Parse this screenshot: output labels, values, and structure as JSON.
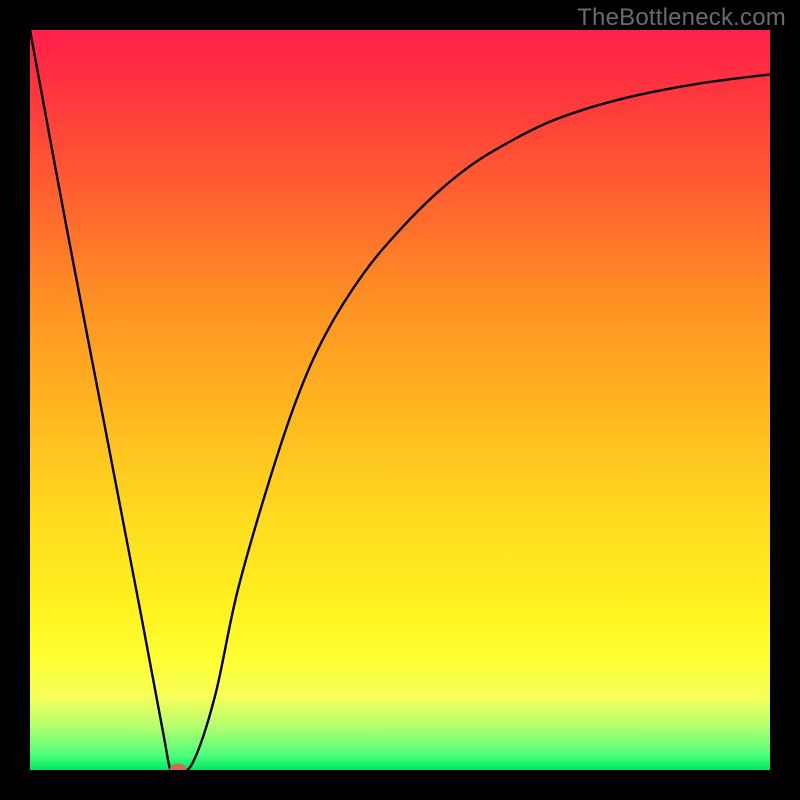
{
  "watermark": "TheBottleneck.com",
  "colors": {
    "frame": "#000000",
    "dot": "#d06a54",
    "curve": "#000000",
    "watermark": "#6b6b6b"
  },
  "gradient_stops": [
    {
      "pct": 0,
      "color": "#ff1f4b"
    },
    {
      "pct": 10,
      "color": "#ff3a3c"
    },
    {
      "pct": 25,
      "color": "#ff6a2d"
    },
    {
      "pct": 38,
      "color": "#ff9522"
    },
    {
      "pct": 52,
      "color": "#ffb81f"
    },
    {
      "pct": 65,
      "color": "#ffd91f"
    },
    {
      "pct": 78,
      "color": "#fff21f"
    },
    {
      "pct": 85,
      "color": "#ffff33"
    },
    {
      "pct": 90,
      "color": "#f7ff58"
    },
    {
      "pct": 94,
      "color": "#b7ff6e"
    },
    {
      "pct": 98,
      "color": "#4cff7a"
    },
    {
      "pct": 100,
      "color": "#00e765"
    }
  ],
  "chart_data": {
    "type": "line",
    "title": "",
    "xlabel": "",
    "ylabel": "",
    "xlim": [
      0,
      100
    ],
    "ylim": [
      0,
      100
    ],
    "grid": false,
    "legend": false,
    "series": [
      {
        "name": "curve",
        "x": [
          0,
          5,
          10,
          15,
          18,
          19,
          20,
          22,
          25,
          28,
          32,
          36,
          40,
          45,
          50,
          55,
          60,
          65,
          70,
          75,
          80,
          85,
          90,
          95,
          100
        ],
        "y": [
          100,
          73,
          47,
          21,
          5,
          0,
          0,
          1,
          10,
          24,
          38,
          50,
          59,
          67,
          73,
          78,
          82,
          85,
          87.5,
          89.3,
          90.7,
          91.8,
          92.7,
          93.4,
          94
        ]
      }
    ],
    "marker": {
      "x": 20,
      "y": 0,
      "color": "#d06a54"
    },
    "background": "vertical-gradient red→green"
  }
}
